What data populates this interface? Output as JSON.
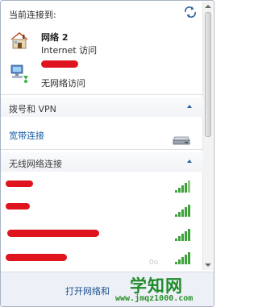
{
  "header": {
    "title": "当前连接到:"
  },
  "connections": [
    {
      "name": "网络  2",
      "status": "Internet 访问",
      "icon": "home-network-icon"
    },
    {
      "status": "无网络访问",
      "icon": "public-network-icon"
    }
  ],
  "dialup": {
    "title": "拨号和 VPN",
    "items": [
      {
        "label": "宽带连接",
        "icon": "broadband-drive-icon"
      }
    ]
  },
  "wireless": {
    "title": "无线网络连接",
    "networks": [
      {
        "signal_bars": 5
      },
      {
        "signal_bars": 5
      },
      {
        "signal_bars": 5
      },
      {
        "signal_bars": 5
      }
    ]
  },
  "footer": {
    "link": "打开网络和"
  },
  "watermark": {
    "title": "学知网",
    "url": "www.jmqz1000.com",
    "ghost": "0o"
  },
  "colors": {
    "link": "#1a5ea8",
    "redaction": "#e0141e",
    "signal": "#3fa23a",
    "watermark": "#1f8a2a"
  }
}
